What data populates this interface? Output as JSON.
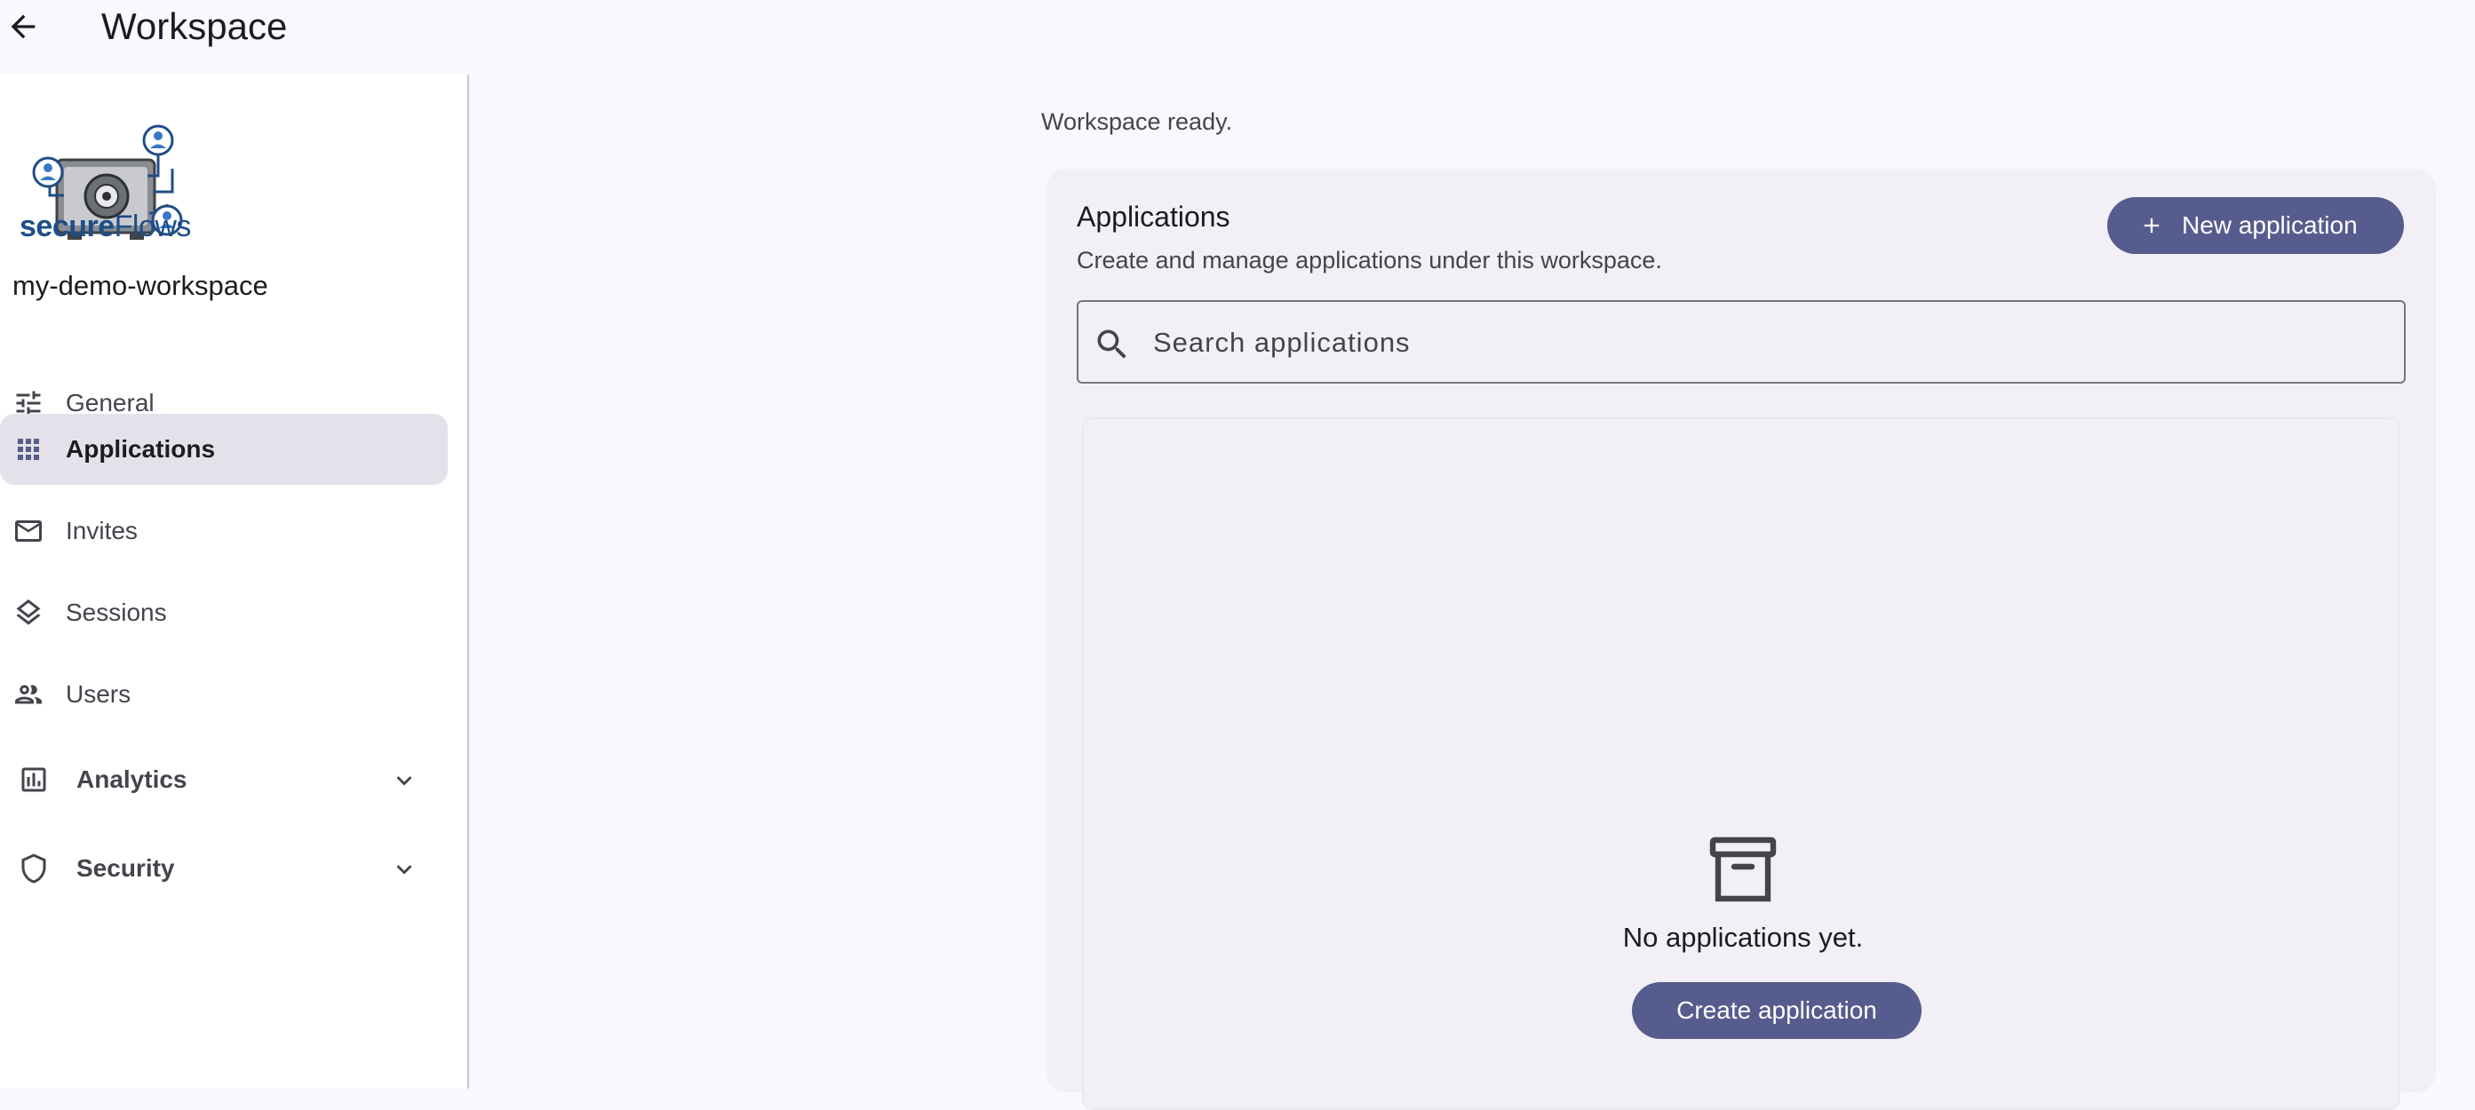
{
  "header": {
    "title": "Workspace",
    "back_icon": "arrow-left-icon"
  },
  "sidebar": {
    "logo": {
      "text_bold": "secure",
      "text_regular": "Flows"
    },
    "workspace_name": "my-demo-workspace",
    "items": [
      {
        "label": "General",
        "icon": "tune-icon",
        "active": false
      },
      {
        "label": "Applications",
        "icon": "apps-grid-icon",
        "active": true
      },
      {
        "label": "Invites",
        "icon": "mail-icon",
        "active": false
      },
      {
        "label": "Sessions",
        "icon": "layers-icon",
        "active": false
      },
      {
        "label": "Users",
        "icon": "users-icon",
        "active": false
      }
    ],
    "groups": [
      {
        "label": "Analytics",
        "icon": "analytics-icon",
        "expanded": false
      },
      {
        "label": "Security",
        "icon": "shield-icon",
        "expanded": false
      }
    ]
  },
  "main": {
    "status": "Workspace ready.",
    "panel": {
      "title": "Applications",
      "subtitle": "Create and manage applications under this workspace.",
      "new_button": "New application",
      "search": {
        "placeholder": "Search applications",
        "value": ""
      },
      "empty": {
        "icon": "archive-box-icon",
        "message": "No applications yet.",
        "button": "Create application"
      }
    }
  },
  "colors": {
    "accent": "#575c8e",
    "background": "#f9f8fc",
    "panel": "#f2f0f6",
    "active_nav": "#e4e1ea",
    "logo_blue": "#1f4e87"
  }
}
